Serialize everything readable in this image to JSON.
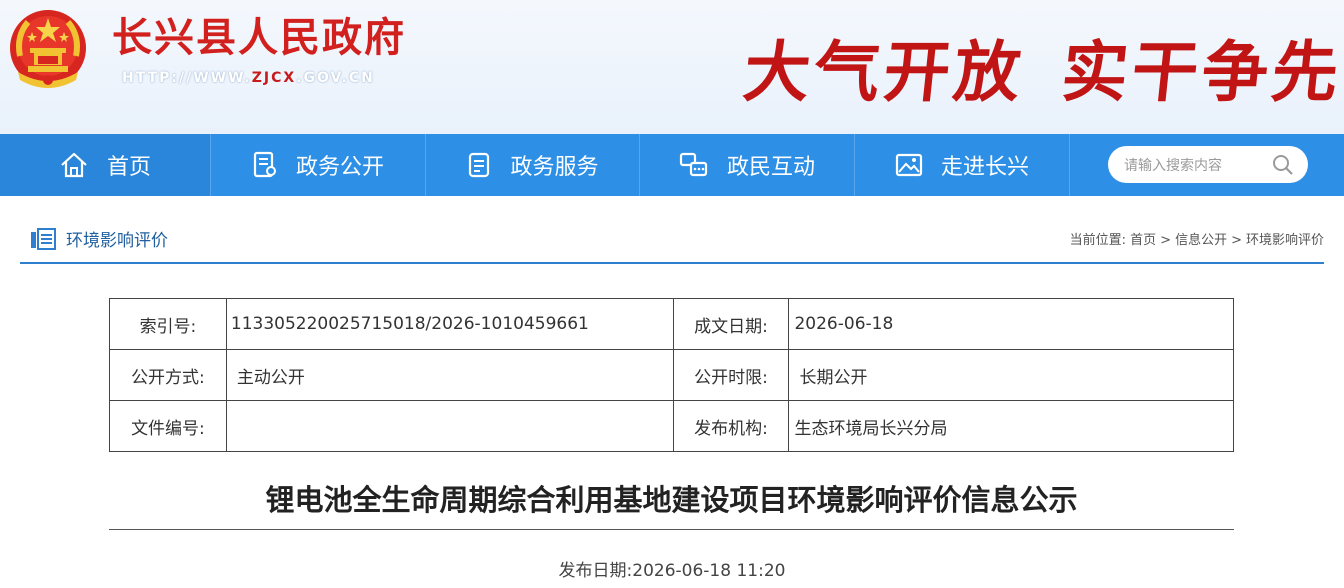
{
  "header": {
    "site_title": "长兴县人民政府",
    "site_url_prefix": "HTTP://WWW.",
    "site_url_accent": "ZJCX",
    "site_url_suffix": ".GOV.CN",
    "slogan_left": "大气开放",
    "slogan_right": "实干争先"
  },
  "nav": {
    "items": [
      {
        "label": "首页",
        "icon": "home-icon"
      },
      {
        "label": "政务公开",
        "icon": "document-icon"
      },
      {
        "label": "政务服务",
        "icon": "clipboard-icon"
      },
      {
        "label": "政民互动",
        "icon": "chat-icon"
      },
      {
        "label": "走进长兴",
        "icon": "picture-icon"
      }
    ],
    "search_placeholder": "请输入搜索内容"
  },
  "section": {
    "title": "环境影响评价",
    "breadcrumb_label": "当前位置:",
    "breadcrumb": [
      "首页",
      "信息公开",
      "环境影响评价"
    ],
    "breadcrumb_sep": ">"
  },
  "meta": {
    "index_label": "索引号:",
    "index_value": "113305220025715018/2026-1010459661",
    "date_label": "成文日期:",
    "date_value": "2026-06-18",
    "method_label": "公开方式:",
    "method_value": "主动公开",
    "limit_label": "公开时限:",
    "limit_value": "长期公开",
    "docno_label": "文件编号:",
    "docno_value": "",
    "issuer_label": "发布机构:",
    "issuer_value": "生态环境局长兴分局"
  },
  "article": {
    "title": "锂电池全生命周期综合利用基地建设项目环境影响评价信息公示",
    "pubdate_label": "发布日期:",
    "pubdate_value": "2026-06-18 11:20"
  },
  "colors": {
    "nav_bg": "#2e8fe6",
    "title_red": "#d1201d",
    "section_blue": "#2e7fd0"
  }
}
